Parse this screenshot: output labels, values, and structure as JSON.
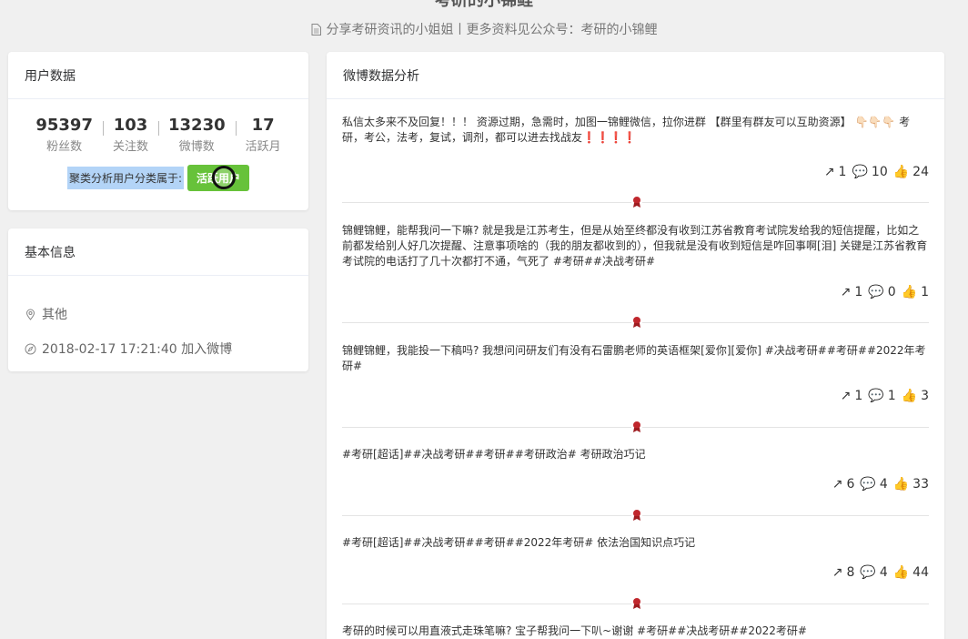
{
  "header": {
    "title": "考研的小锦鲤",
    "subtitle": "分享考研资讯的小姐姐丨更多资料见公众号：考研的小锦鲤"
  },
  "user_card": {
    "title": "用户数据",
    "stats": [
      {
        "value": "95397",
        "label": "粉丝数"
      },
      {
        "value": "103",
        "label": "关注数"
      },
      {
        "value": "13230",
        "label": "微博数"
      },
      {
        "value": "17",
        "label": "活跃月"
      }
    ],
    "cluster_label": "聚类分析用户分类属于:",
    "cluster_tag": "活跃用户"
  },
  "info_card": {
    "title": "基本信息",
    "location": "其他",
    "joined": "2018-02-17 17:21:40 加入微博"
  },
  "weibo_card": {
    "title": "微博数据分析",
    "posts": [
      {
        "text_main": "私信太多来不及回复！！！ 资源过期，急需时，加图一锦鲤微信，拉你进群 【群里有群友可以互助资源】",
        "text_hands": "👇🏻👇🏻👇🏻",
        "text_after": " 考研，考公，法考，复试，调剂，都可以进去找战友",
        "text_bangs": "❗❗❗❗",
        "repost": "1",
        "comment": "10",
        "like": "24"
      },
      {
        "text_main": "锦鲤锦鲤，能帮我问一下嘛? 就是我是江苏考生，但是从始至终都没有收到江苏省教育考试院发给我的短信提醒，比如之前都发给别人好几次提醒、注意事项啥的（我的朋友都收到的），但我就是没有收到短信是咋回事啊[泪] 关键是江苏省教育考试院的电话打了几十次都打不通，气死了 #考研##决战考研#",
        "repost": "1",
        "comment": "0",
        "like": "1"
      },
      {
        "text_main": "锦鲤锦鲤，我能投一下稿吗? 我想问问研友们有没有石雷鹏老师的英语框架[爱你][爱你] #决战考研##考研##2022年考研#",
        "repost": "1",
        "comment": "1",
        "like": "3"
      },
      {
        "text_main": "#考研[超话]##决战考研##考研##考研政治# 考研政治巧记",
        "repost": "6",
        "comment": "4",
        "like": "33"
      },
      {
        "text_main": "#考研[超话]##决战考研##考研##2022年考研# 依法治国知识点巧记",
        "repost": "8",
        "comment": "4",
        "like": "44"
      },
      {
        "text_main": "考研的时候可以用直液式走珠笔嘛? 宝子帮我问一下叭~谢谢 #考研##决战考研##2022考研#"
      }
    ]
  },
  "colors": {
    "tag_green": "#67c23a",
    "selection_blue": "#b3d4f7",
    "ribbon_red": "#c0272d"
  },
  "icons": [
    "document-icon",
    "location-pin-icon",
    "compass-icon",
    "share-icon",
    "comment-icon",
    "thumbs-up-icon",
    "ribbon-icon"
  ]
}
